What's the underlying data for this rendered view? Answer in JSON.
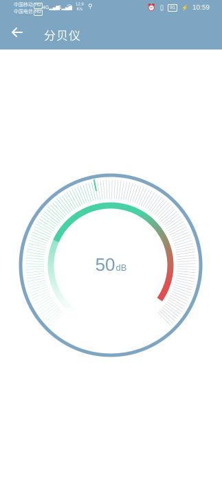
{
  "status": {
    "carrier1": "中国移动",
    "carrier2": "中国电信",
    "hd1": "HD",
    "hd2": "HD",
    "net1": "4G",
    "net2": "4G",
    "speed_value": "12.9",
    "speed_unit": "K/s",
    "battery": "91",
    "time": "10:59"
  },
  "header": {
    "title": "分贝仪"
  },
  "meter": {
    "value": "50",
    "unit": "dB",
    "level_percent": 50
  },
  "colors": {
    "header": "#7ea6c3",
    "ring": "#7ea6c3",
    "arc_start": "#48d1a4",
    "arc_end": "#e05050",
    "text": "#7a9fba"
  },
  "icons": {
    "back": "arrow-left-icon",
    "search": "search-icon",
    "alarm": "alarm-icon",
    "vibrate": "vibrate-icon",
    "wifi": "wifi-icon",
    "charging": "bolt-icon"
  }
}
